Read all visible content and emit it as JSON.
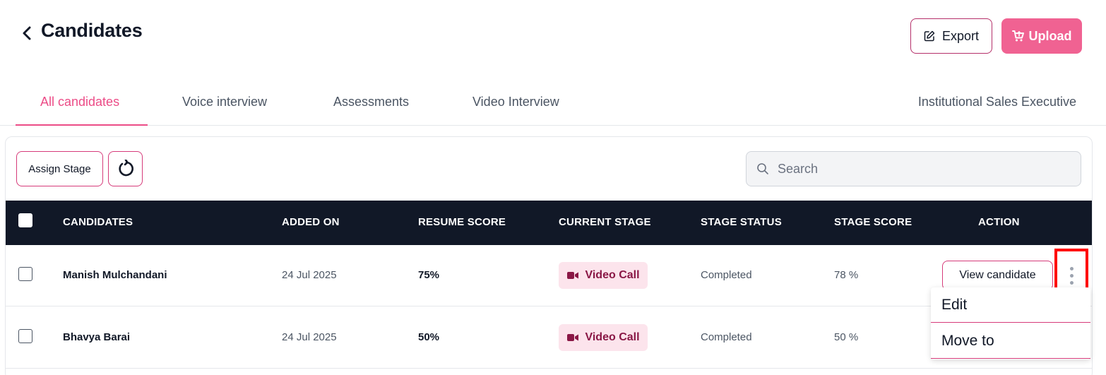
{
  "header": {
    "title": "Candidates",
    "export_label": "Export",
    "upload_label": "Upload"
  },
  "tabs": [
    {
      "label": "All candidates",
      "active": true
    },
    {
      "label": "Voice interview",
      "active": false
    },
    {
      "label": "Assessments",
      "active": false
    },
    {
      "label": "Video Interview",
      "active": false
    }
  ],
  "job_title": "Institutional Sales Executive",
  "toolbar": {
    "assign_stage_label": "Assign Stage",
    "search_placeholder": "Search"
  },
  "table": {
    "columns": [
      "CANDIDATES",
      "ADDED ON",
      "RESUME SCORE",
      "CURRENT STAGE",
      "STAGE STATUS",
      "STAGE SCORE",
      "ACTION"
    ],
    "rows": [
      {
        "name": "Manish Mulchandani",
        "added_on": "24 Jul 2025",
        "resume_score": "75%",
        "stage": "Video Call",
        "status": "Completed",
        "stage_score": "78 %"
      },
      {
        "name": "Bhavya Barai",
        "added_on": "24 Jul 2025",
        "resume_score": "50%",
        "stage": "Video Call",
        "status": "Completed",
        "stage_score": "50 %"
      }
    ],
    "view_label": "View candidate"
  },
  "menu": {
    "items": [
      "Edit",
      "Move to"
    ]
  },
  "colors": {
    "accent": "#ec4c87",
    "upload_bg": "#f06292",
    "header_bg": "#111827",
    "badge_bg": "#fce4ec",
    "badge_text": "#8a1846",
    "highlight": "#ff0000"
  }
}
